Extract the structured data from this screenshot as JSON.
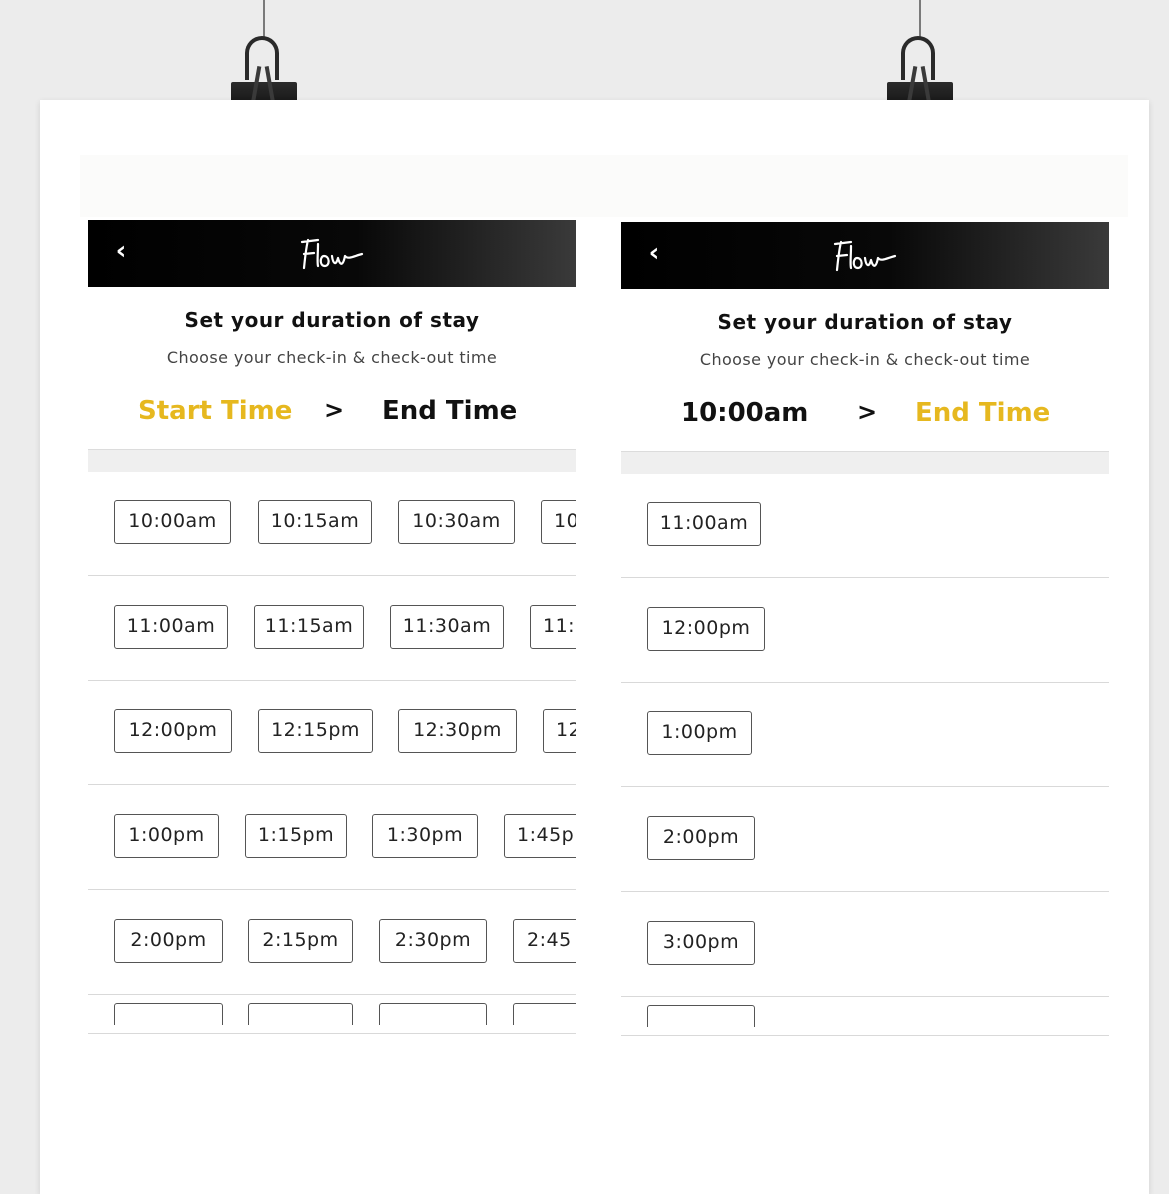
{
  "app": {
    "brand": "Flow"
  },
  "screens": [
    {
      "title": "Set your duration of stay",
      "subtitle": "Choose your check-in & check-out time",
      "steps": {
        "first": "Start Time",
        "separator": ">",
        "second": "End Time",
        "active": "first"
      },
      "rows": [
        [
          "10:00am",
          "10:15am",
          "10:30am",
          "10"
        ],
        [
          "11:00am",
          "11:15am",
          "11:30am",
          "11:"
        ],
        [
          "12:00pm",
          "12:15pm",
          "12:30pm",
          "12"
        ],
        [
          "1:00pm",
          "1:15pm",
          "1:30pm",
          "1:45p"
        ],
        [
          "2:00pm",
          "2:15pm",
          "2:30pm",
          "2:45"
        ]
      ]
    },
    {
      "title": "Set your duration of stay",
      "subtitle": "Choose your check-in & check-out time",
      "steps": {
        "first": "10:00am",
        "separator": ">",
        "second": "End Time",
        "active": "second"
      },
      "rows": [
        [
          "11:00am"
        ],
        [
          "12:00pm"
        ],
        [
          "1:00pm"
        ],
        [
          "2:00pm"
        ],
        [
          "3:00pm"
        ]
      ]
    }
  ],
  "colors": {
    "accent": "#e6b81f",
    "appbar": "#000000",
    "border": "#555555"
  },
  "icons": {
    "back": "back-chevron-icon",
    "separator": "chevron-right-icon",
    "clip": "binder-clip-icon"
  }
}
